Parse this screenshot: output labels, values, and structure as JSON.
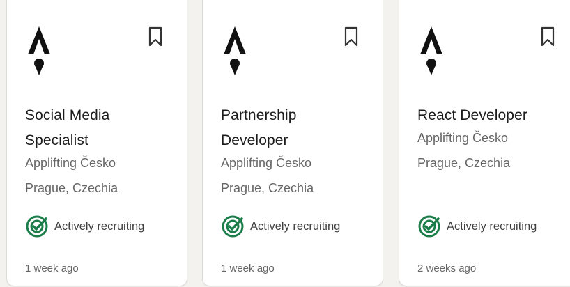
{
  "colors": {
    "logo": "#111111",
    "badge_green": "#1b7d4a",
    "title": "#1d1d1d",
    "meta": "#666666"
  },
  "icons": {
    "logo": "company-logo-icon",
    "bookmark": "bookmark-icon",
    "recruiting": "target-check-icon"
  },
  "jobs": [
    {
      "title_lines": [
        "Social Media",
        "Specialist"
      ],
      "company": "Applifting Česko",
      "location": "Prague, Czechia",
      "badge": "Actively recruiting",
      "posted": "1 week ago"
    },
    {
      "title_lines": [
        "Partnership",
        "Developer"
      ],
      "company": "Applifting Česko",
      "location": "Prague, Czechia",
      "badge": "Actively recruiting",
      "posted": "1 week ago"
    },
    {
      "title_lines": [
        "React Developer"
      ],
      "company": "Applifting Česko",
      "location": "Prague, Czechia",
      "badge": "Actively recruiting",
      "posted": "2 weeks ago"
    }
  ]
}
